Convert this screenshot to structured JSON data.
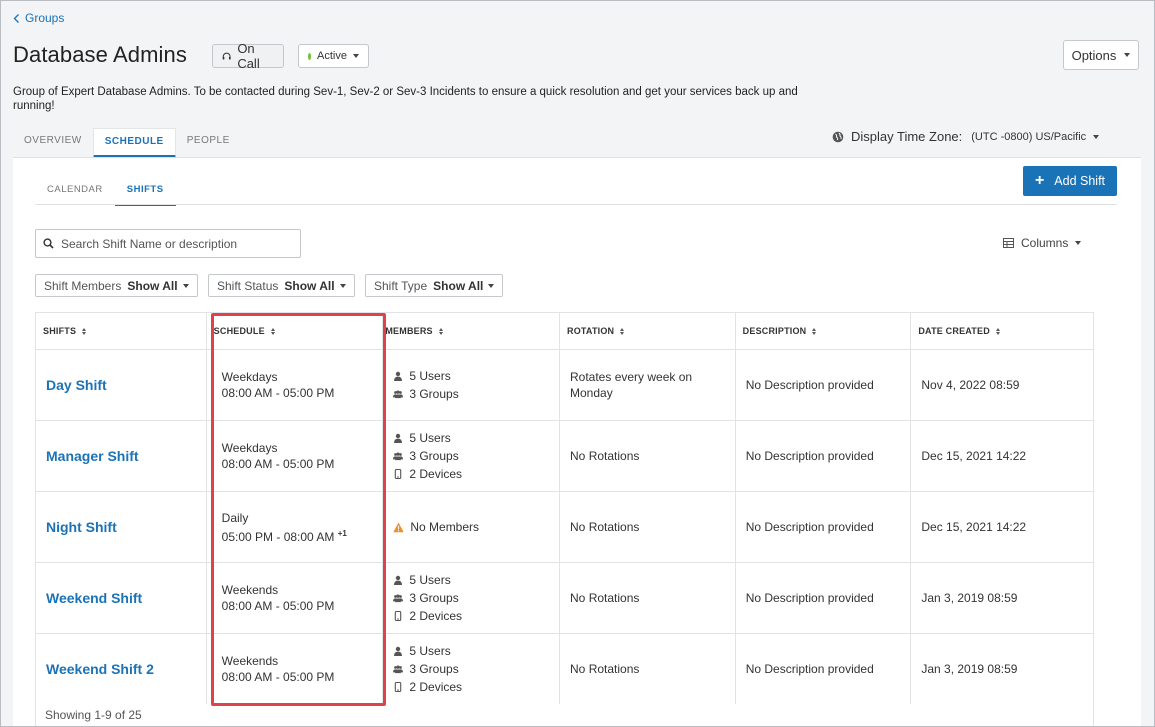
{
  "back": {
    "label": "Groups"
  },
  "group": {
    "title": "Database Admins",
    "oncall_label": "On Call",
    "status_label": "Active",
    "options_label": "Options",
    "description": "Group of Expert Database Admins. To be contacted during Sev-1, Sev-2 or Sev-3 Incidents to ensure a quick resolution and get your services back up and running!"
  },
  "main_tabs": [
    {
      "label": "OVERVIEW"
    },
    {
      "label": "SCHEDULE"
    },
    {
      "label": "PEOPLE"
    }
  ],
  "timezone": {
    "label": "Display Time Zone:",
    "value": "(UTC -0800) US/Pacific"
  },
  "sub_tabs": [
    {
      "label": "CALENDAR"
    },
    {
      "label": "SHIFTS"
    }
  ],
  "add_shift_label": "Add Shift",
  "search": {
    "placeholder": "Search Shift Name or description"
  },
  "columns_label": "Columns",
  "filters": [
    {
      "label": "Shift Members",
      "value": "Show All"
    },
    {
      "label": "Shift Status",
      "value": "Show All"
    },
    {
      "label": "Shift Type",
      "value": "Show All"
    }
  ],
  "table": {
    "headers": [
      "SHIFTS",
      "SCHEDULE",
      "MEMBERS",
      "ROTATION",
      "DESCRIPTION",
      "DATE CREATED"
    ],
    "rows": [
      {
        "name": "Day Shift",
        "schedule_days": "Weekdays",
        "schedule_time": "08:00 AM - 05:00 PM",
        "members": [
          "5 Users",
          "3 Groups"
        ],
        "rotation": "Rotates every week on Monday",
        "description": "No Description provided",
        "created": "Nov 4, 2022 08:59"
      },
      {
        "name": "Manager Shift",
        "schedule_days": "Weekdays",
        "schedule_time": "08:00 AM - 05:00 PM",
        "members": [
          "5 Users",
          "3 Groups",
          "2 Devices"
        ],
        "rotation": "No Rotations",
        "description": "No Description provided",
        "created": "Dec 15, 2021 14:22"
      },
      {
        "name": "Night Shift",
        "schedule_days": "Daily",
        "schedule_time": "05:00 PM - 08:00 AM",
        "schedule_sup": "+1",
        "members_warning": "No Members",
        "rotation": "No Rotations",
        "description": "No Description provided",
        "created": "Dec 15, 2021 14:22"
      },
      {
        "name": "Weekend Shift",
        "schedule_days": "Weekends",
        "schedule_time": "08:00 AM - 05:00 PM",
        "members": [
          "5 Users",
          "3 Groups",
          "2 Devices"
        ],
        "rotation": "No Rotations",
        "description": "No Description provided",
        "created": "Jan 3, 2019 08:59"
      },
      {
        "name": "Weekend Shift 2",
        "schedule_days": "Weekends",
        "schedule_time": "08:00 AM - 05:00 PM",
        "members": [
          "5 Users",
          "3 Groups",
          "2 Devices"
        ],
        "rotation": "No Rotations",
        "description": "No Description provided",
        "created": "Jan 3, 2019 08:59"
      }
    ]
  },
  "footer": {
    "showing": "Showing 1-9 of 25"
  },
  "colors": {
    "accent": "#1b73b7",
    "active_dot": "#74c12e",
    "warning": "#f0901e",
    "highlight": "#e0424c"
  }
}
